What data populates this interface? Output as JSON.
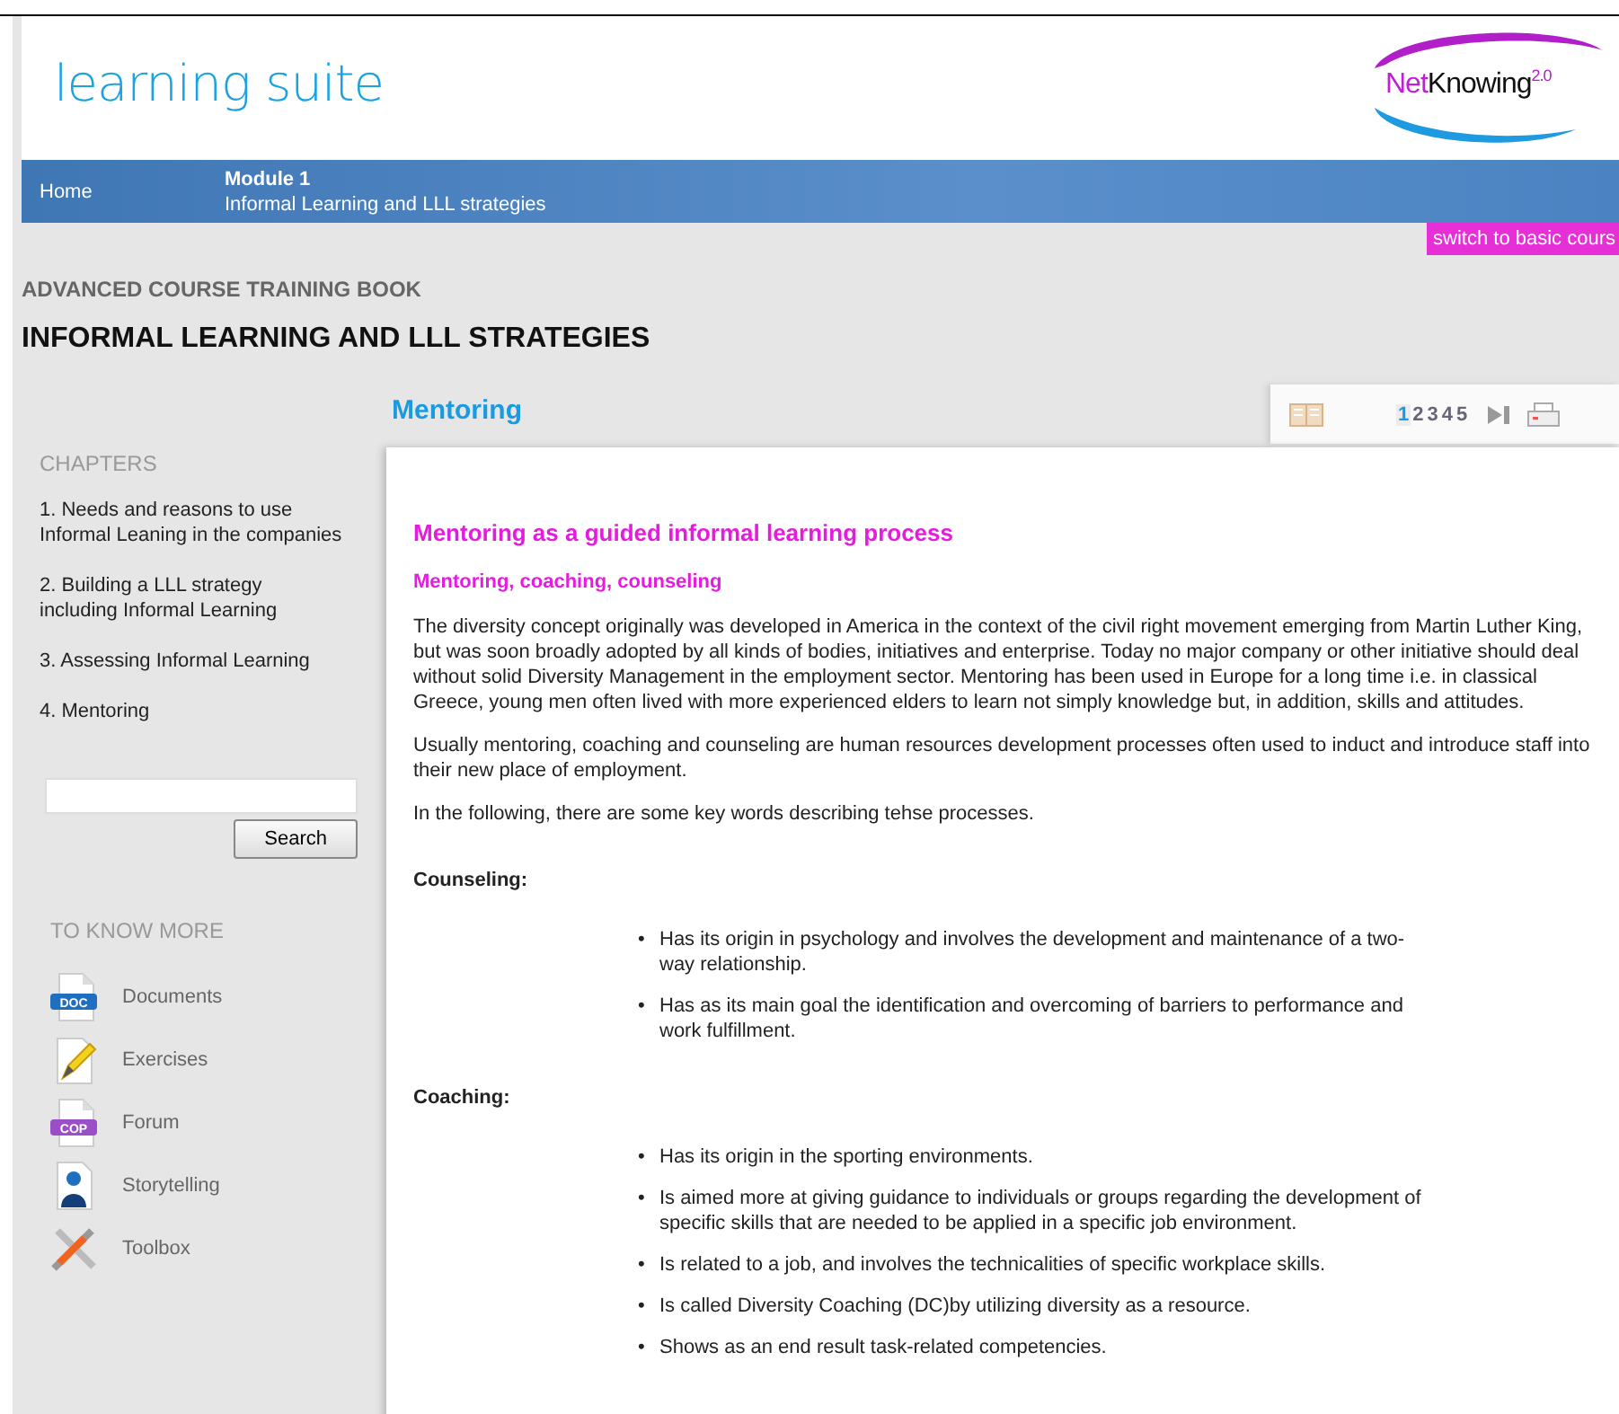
{
  "header": {
    "title": "learning suite",
    "logo": {
      "name": "NetKnowing",
      "superscript": "2.0"
    }
  },
  "navbar": {
    "home": "Home",
    "module": "Module 1",
    "module_title": "Informal Learning and LLL strategies"
  },
  "switch_button": "switch to basic cours",
  "book_label": "ADVANCED COURSE TRAINING BOOK",
  "book_title": "INFORMAL LEARNING AND LLL STRATEGIES",
  "sidebar": {
    "chapters_heading": "CHAPTERS",
    "chapters": [
      {
        "label": "1. Needs and reasons to use Informal Leaning in the companies"
      },
      {
        "label": "2. Building a LLL strategy including Informal Learning"
      },
      {
        "label": "3. Assessing Informal Learning"
      },
      {
        "label": "4. Mentoring"
      }
    ],
    "search_button": "Search",
    "more_heading": "TO KNOW MORE",
    "more_items": [
      {
        "label": "Documents",
        "kind": "doc",
        "icon_text": "DOC"
      },
      {
        "label": "Exercises",
        "kind": "pencil"
      },
      {
        "label": "Forum",
        "kind": "cop",
        "icon_text": "COP"
      },
      {
        "label": "Storytelling",
        "kind": "person"
      },
      {
        "label": "Toolbox",
        "kind": "tools"
      }
    ]
  },
  "section_title": "Mentoring",
  "pager": {
    "pages": [
      {
        "label": "1",
        "selected": true
      },
      {
        "label": "2",
        "selected": false
      },
      {
        "label": "3",
        "selected": false
      },
      {
        "label": "4",
        "selected": false
      },
      {
        "label": "5",
        "selected": false
      }
    ]
  },
  "article": {
    "title": "Mentoring as a guided informal learning process",
    "subtitle": "Mentoring, coaching, counseling",
    "paragraphs": [
      "The diversity concept originally was developed in America in the context of the civil right movement emerging from Martin Luther King, but was soon broadly adopted by all kinds of bodies, initiatives and enterprise. Today no major company or other initiative should deal without solid Diversity Management in the employment sector. Mentoring has been used in Europe for a long time i.e. in classical Greece, young men often lived with more experienced elders to learn not simply knowledge but, in addition, skills and attitudes.",
      "Usually mentoring, coaching and counseling are human resources development processes often used to induct and introduce staff into their new place of employment.",
      "In the following, there are some key words describing tehse processes."
    ],
    "bullet_marker": "•",
    "sections": [
      {
        "heading": "Counseling:",
        "bullets": [
          "Has its origin in psychology and involves the development and maintenance of a two-way relationship.",
          "Has as its main goal the identification and overcoming of barriers to performance and work fulfillment."
        ]
      },
      {
        "heading": "Coaching:",
        "bullets": [
          "Has its origin in the sporting environments.",
          "Is aimed more at giving guidance to individuals or groups regarding the development of specific skills that are needed to be applied in a specific job environment.",
          "Is related to a job, and involves the technicalities of specific workplace skills.",
          "Is called Diversity Coaching (DC)by utilizing diversity as a resource.",
          "Shows as an end result task-related competencies."
        ]
      }
    ]
  }
}
